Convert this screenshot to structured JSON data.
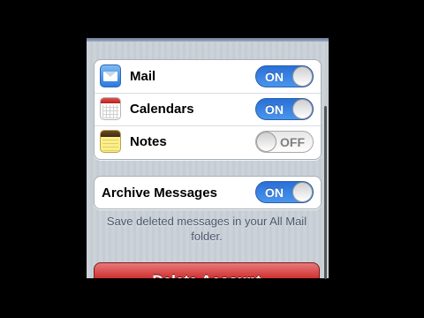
{
  "accounts": {
    "items": [
      {
        "label": "Mail",
        "icon": "mail-icon",
        "toggle": "ON"
      },
      {
        "label": "Calendars",
        "icon": "calendar-icon",
        "toggle": "ON"
      },
      {
        "label": "Notes",
        "icon": "notes-icon",
        "toggle": "OFF"
      }
    ]
  },
  "archive": {
    "label": "Archive Messages",
    "toggle": "ON",
    "note": "Save deleted messages in your All Mail folder."
  },
  "delete_button": {
    "label": "Delete Account"
  },
  "colors": {
    "toggle_on": "#2a6fd7",
    "delete_red": "#c8201f",
    "background": "#c5ccd4"
  }
}
